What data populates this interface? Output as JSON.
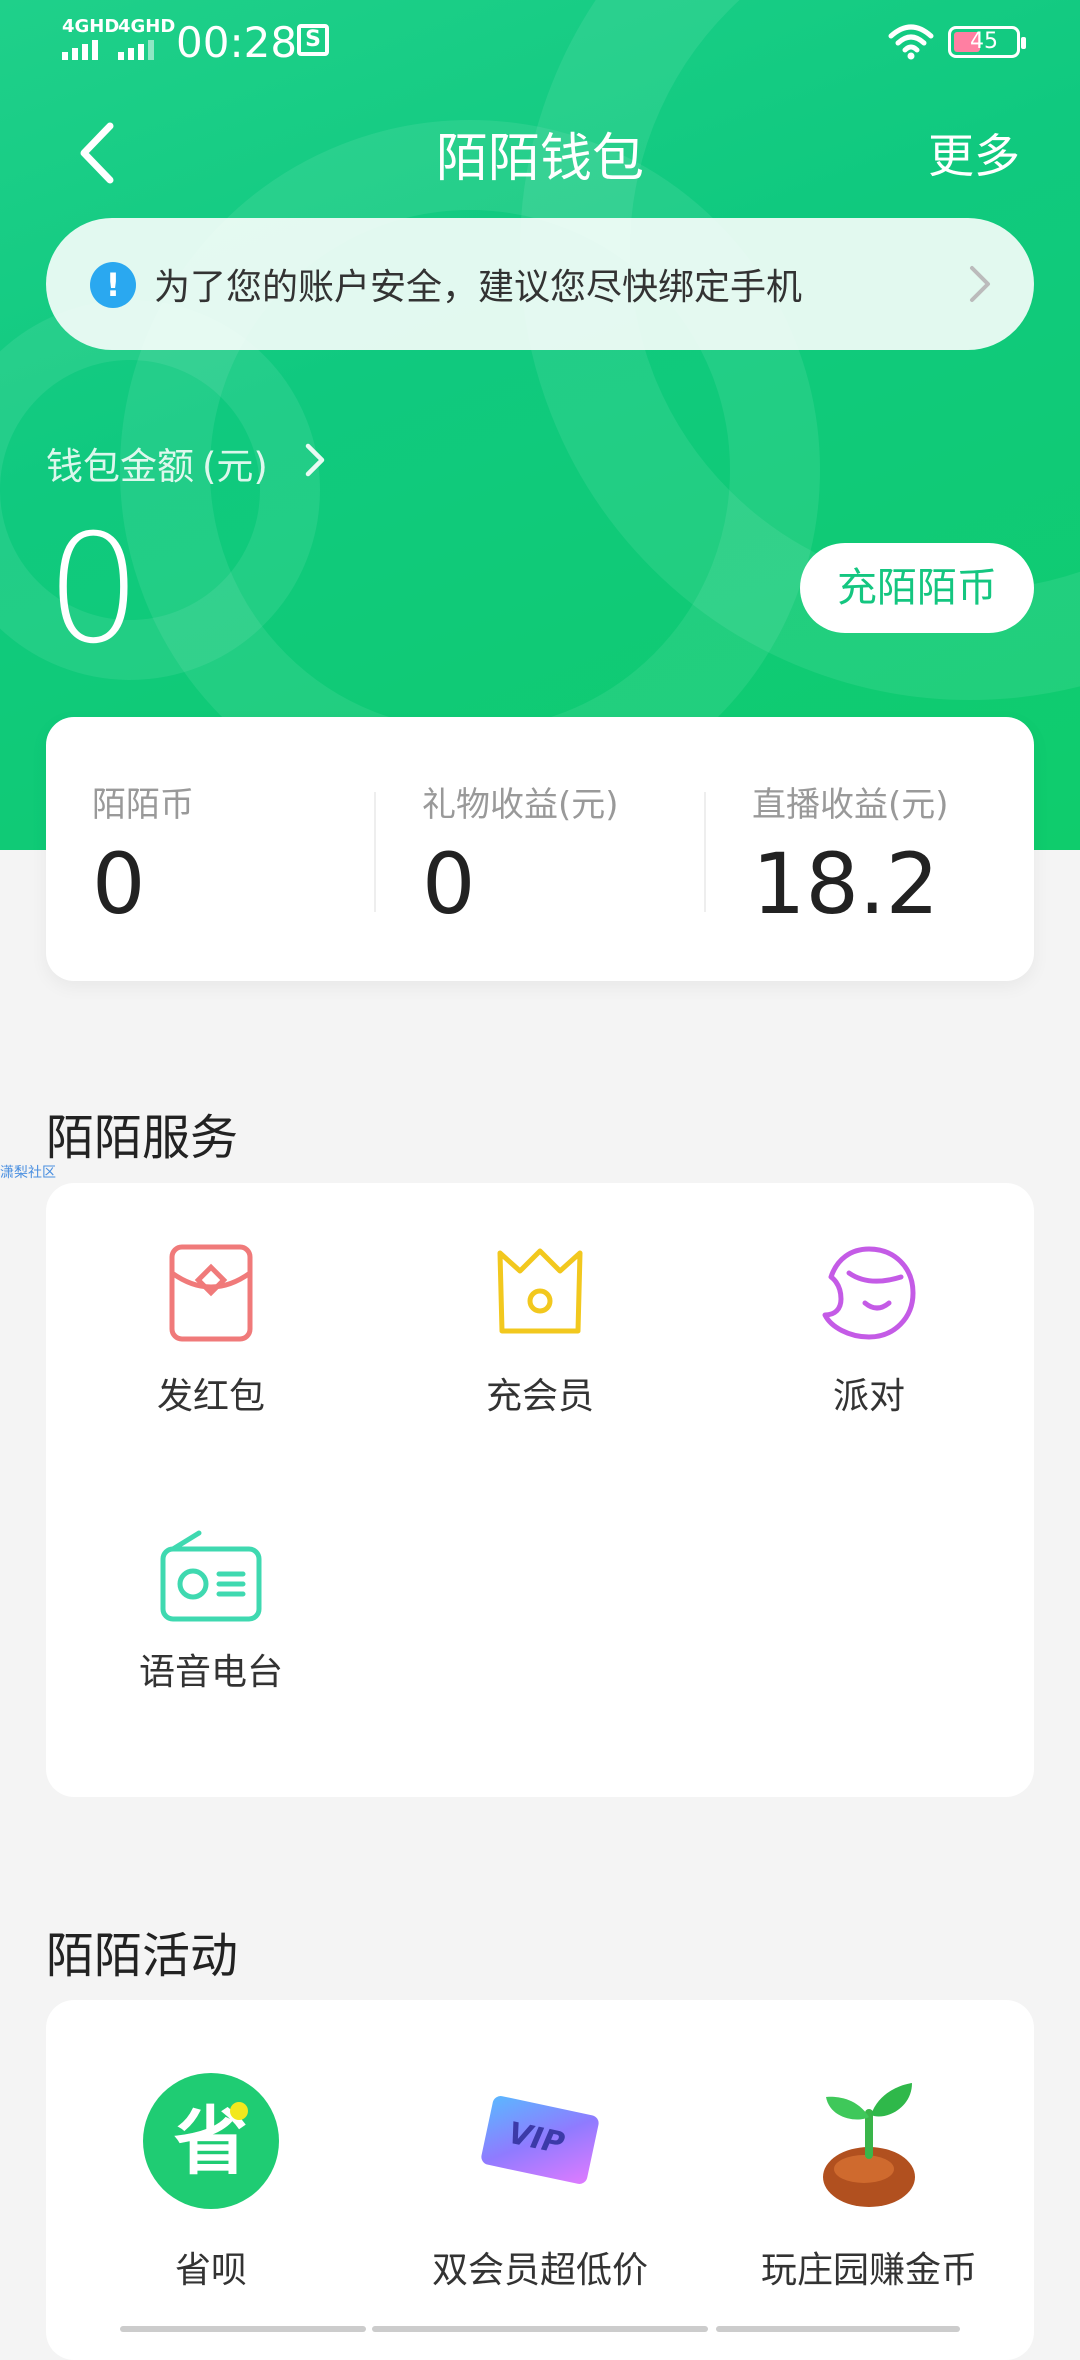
{
  "status_bar": {
    "network_1": "4GHD",
    "network_2": "4GHD",
    "time": "00:28",
    "battery": "45"
  },
  "nav": {
    "title": "陌陌钱包",
    "more": "更多"
  },
  "security_banner": {
    "text": "为了您的账户安全，建议您尽快绑定手机"
  },
  "wallet": {
    "label": "钱包金额",
    "unit": "(元)",
    "amount": "0",
    "recharge_button": "充陌陌币"
  },
  "balances": [
    {
      "label": "陌陌币",
      "value": "0"
    },
    {
      "label": "礼物收益(元)",
      "value": "0"
    },
    {
      "label": "直播收益(元)",
      "value": "18.2"
    }
  ],
  "services": {
    "title": "陌陌服务",
    "items": [
      {
        "label": "发红包",
        "icon": "red-packet-icon"
      },
      {
        "label": "充会员",
        "icon": "crown-icon"
      },
      {
        "label": "派对",
        "icon": "party-face-icon"
      },
      {
        "label": "语音电台",
        "icon": "radio-icon"
      }
    ]
  },
  "activities": {
    "title": "陌陌活动",
    "items": [
      {
        "label": "省呗",
        "icon": "sheng-bei-icon"
      },
      {
        "label": "双会员超低价",
        "icon": "vip-card-icon"
      },
      {
        "label": "玩庄园赚金币",
        "icon": "sprout-icon"
      }
    ]
  },
  "watermark": "潇梨社区",
  "colors": {
    "brand_green": "#14c680",
    "info_blue": "#2aa8f0",
    "red_packet": "#f07a7a",
    "crown_yellow": "#f2c81e",
    "party_purple": "#c45be6",
    "radio_teal": "#3fd9b0"
  }
}
